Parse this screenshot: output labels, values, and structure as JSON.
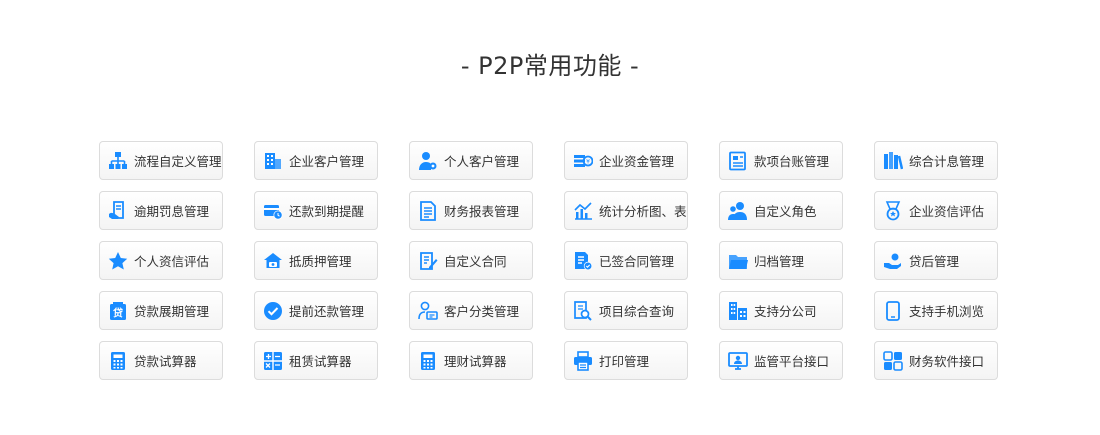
{
  "page": {
    "title": "- P2P常用功能 -"
  },
  "accent": "#1a8cff",
  "items": [
    {
      "label": "流程自定义管理",
      "icon": "org-chart-icon"
    },
    {
      "label": "企业客户管理",
      "icon": "building-icon"
    },
    {
      "label": "个人客户管理",
      "icon": "user-gear-icon"
    },
    {
      "label": "企业资金管理",
      "icon": "money-icon"
    },
    {
      "label": "款项台账管理",
      "icon": "ledger-icon"
    },
    {
      "label": "综合计息管理",
      "icon": "books-icon"
    },
    {
      "label": "逾期罚息管理",
      "icon": "document-hand-icon"
    },
    {
      "label": "还款到期提醒",
      "icon": "card-clock-icon"
    },
    {
      "label": "财务报表管理",
      "icon": "report-icon"
    },
    {
      "label": "统计分析图、表",
      "icon": "chart-icon"
    },
    {
      "label": "自定义角色",
      "icon": "users-icon"
    },
    {
      "label": "企业资信评估",
      "icon": "medal-icon"
    },
    {
      "label": "个人资信评估",
      "icon": "star-icon"
    },
    {
      "label": "抵质押管理",
      "icon": "house-icon"
    },
    {
      "label": "自定义合同",
      "icon": "contract-edit-icon"
    },
    {
      "label": "已签合同管理",
      "icon": "signed-contract-icon"
    },
    {
      "label": "归档管理",
      "icon": "folder-icon"
    },
    {
      "label": "贷后管理",
      "icon": "hand-coin-icon"
    },
    {
      "label": "贷款展期管理",
      "icon": "loan-icon"
    },
    {
      "label": "提前还款管理",
      "icon": "check-circle-icon"
    },
    {
      "label": "客户分类管理",
      "icon": "user-card-icon"
    },
    {
      "label": "项目综合查询",
      "icon": "search-document-icon"
    },
    {
      "label": "支持分公司",
      "icon": "branch-office-icon"
    },
    {
      "label": "支持手机浏览",
      "icon": "mobile-icon"
    },
    {
      "label": "贷款试算器",
      "icon": "calculator-icon"
    },
    {
      "label": "租赁试算器",
      "icon": "calc-plus-minus-icon"
    },
    {
      "label": "理财试算器",
      "icon": "calculator-icon"
    },
    {
      "label": "打印管理",
      "icon": "printer-icon"
    },
    {
      "label": "监管平台接口",
      "icon": "monitor-user-icon"
    },
    {
      "label": "财务软件接口",
      "icon": "app-tiles-icon"
    }
  ]
}
